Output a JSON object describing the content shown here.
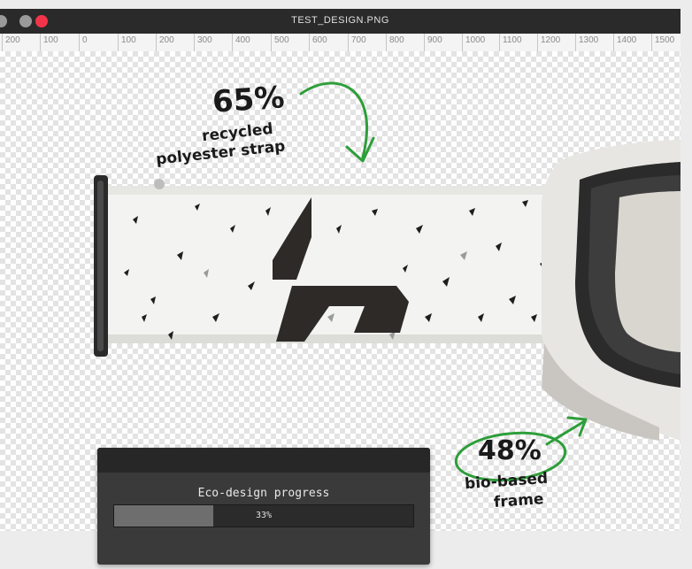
{
  "window": {
    "title": "TEST_DESIGN.PNG"
  },
  "ruler": {
    "labels": [
      "200",
      "100",
      "0",
      "100",
      "200",
      "300",
      "400",
      "500",
      "600",
      "700",
      "800",
      "900",
      "1000",
      "1100",
      "1200",
      "1300",
      "1400",
      "1500"
    ]
  },
  "canvas": {
    "annotation_top": {
      "percent": "65%",
      "line1": "recycled",
      "line2": "polyester strap"
    },
    "annotation_bottom": {
      "percent": "48%",
      "line1": "bio-based",
      "line2": "frame"
    },
    "accent_color": "#2e9e3a"
  },
  "progress_panel": {
    "title": "Eco-design progress",
    "value_label": "33%",
    "progress_fraction": 0.33
  }
}
